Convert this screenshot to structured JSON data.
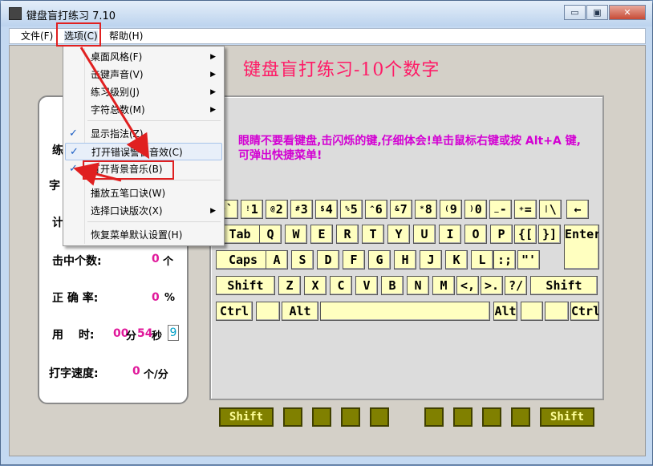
{
  "app": {
    "title": "键盘盲打练习 7.10"
  },
  "window_buttons": {
    "minimize": "▭",
    "restore": "▣",
    "close": "✕"
  },
  "menubar": {
    "file": "文件(F)",
    "options": "选项(C)",
    "help": "帮助(H)"
  },
  "main_title": "键盘盲打练习-10个数字",
  "hint": "眼睛不要看键盘,击闪烁的键,仔细体会!单击鼠标右键或按 Alt+A 键,可弹出快捷菜单!",
  "stats": {
    "l1": "练",
    "l2": "字",
    "l3": "计",
    "hits_label": "击中个数:",
    "hits_value": "0",
    "hits_unit": "个",
    "acc_label": "正 确 率:",
    "acc_value": "0",
    "acc_unit": "%",
    "time_label": "用　 时:",
    "time_min": "00",
    "time_min_unit": "分",
    "time_sec": "54",
    "time_sec_unit": "秒",
    "time_sub": "9",
    "speed_label": "打字速度:",
    "speed_value": "0",
    "speed_unit": "个/分"
  },
  "dropdown": {
    "items": [
      {
        "label": "桌面风格(F)",
        "sub": true
      },
      {
        "label": "击键声音(V)",
        "sub": true
      },
      {
        "label": "练习级别(J)",
        "sub": true
      },
      {
        "label": "字符总数(M)",
        "sub": true
      },
      {
        "label": "显示指法(Z)",
        "checked": true
      },
      {
        "label": "打开错误警告音效(C)",
        "checked": true
      },
      {
        "label": "打开背景音乐(B)",
        "checked": true
      },
      {
        "label": "播放五笔口诀(W)"
      },
      {
        "label": "选择口诀版次(X)",
        "sub": true
      },
      {
        "label": "恢复菜单默认设置(H)"
      }
    ]
  },
  "keyboard": {
    "row1": [
      {
        "s": "~",
        "m": "`"
      },
      {
        "s": "!",
        "m": "1"
      },
      {
        "s": "@",
        "m": "2"
      },
      {
        "s": "#",
        "m": "3"
      },
      {
        "s": "$",
        "m": "4"
      },
      {
        "s": "%",
        "m": "5"
      },
      {
        "s": "^",
        "m": "6"
      },
      {
        "s": "&",
        "m": "7"
      },
      {
        "s": "*",
        "m": "8"
      },
      {
        "s": "(",
        "m": "9"
      },
      {
        "s": ")",
        "m": "0"
      },
      {
        "s": "_",
        "m": "-"
      },
      {
        "s": "+",
        "m": "="
      },
      {
        "s": "|",
        "m": "\\"
      },
      {
        "s": "",
        "m": "←"
      }
    ],
    "row2": [
      "Tab",
      "Q",
      "W",
      "E",
      "R",
      "T",
      "Y",
      "U",
      "I",
      "O",
      "P",
      "{[",
      "}]",
      "Enter↵"
    ],
    "row3": [
      "Caps",
      "A",
      "S",
      "D",
      "F",
      "G",
      "H",
      "J",
      "K",
      "L",
      ":;",
      "\"'"
    ],
    "row4": [
      "Shift",
      "Z",
      "X",
      "C",
      "V",
      "B",
      "N",
      "M",
      "<,",
      ">.",
      "?/",
      "Shift"
    ],
    "row5": [
      "Ctrl",
      "",
      "Alt",
      "",
      "Alt",
      "",
      "",
      "Ctrl"
    ],
    "bottom": [
      "Shift",
      "",
      "",
      "",
      "",
      "",
      "",
      "",
      "",
      "Shift"
    ]
  },
  "colors": {
    "accent_title": "#ff1a66",
    "hint": "#d300d3",
    "value": "#e0189a",
    "key_face": "#ffffc0",
    "bottom_key": "#808000"
  }
}
